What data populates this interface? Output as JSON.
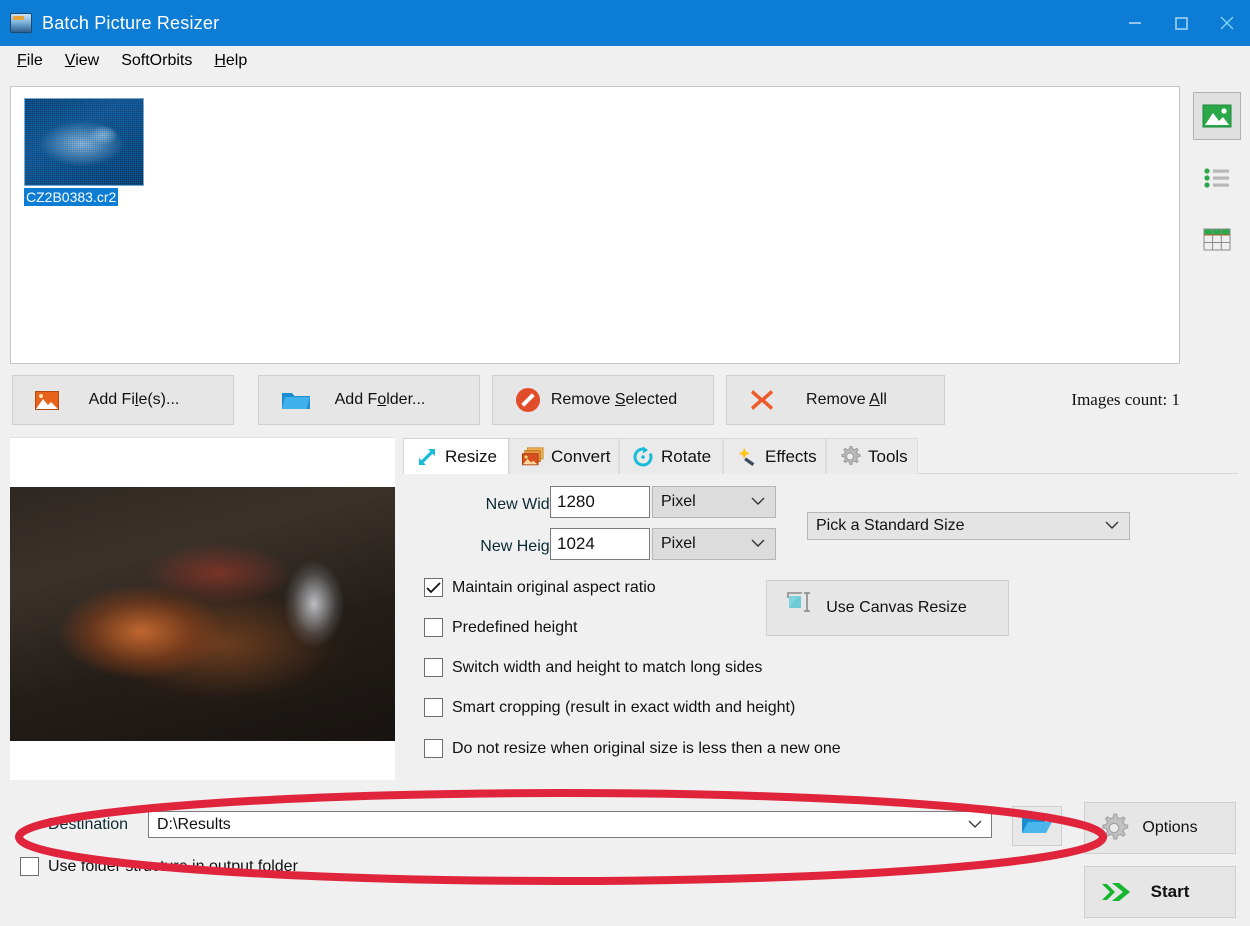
{
  "window": {
    "title": "Batch Picture Resizer",
    "app_icon": "app-picture-icon",
    "controls": {
      "minimize": "minimize-icon",
      "maximize": "maximize-icon",
      "close": "close-icon"
    },
    "titlebar_color": "#0c7cd5"
  },
  "menu": {
    "items": [
      {
        "label": "File",
        "accel": "F"
      },
      {
        "label": "View",
        "accel": "V"
      },
      {
        "label": "SoftOrbits",
        "accel": ""
      },
      {
        "label": "Help",
        "accel": "H"
      }
    ]
  },
  "filelist": {
    "thumbnails": [
      {
        "filename": "CZ2B0383.cr2",
        "selected": true
      }
    ]
  },
  "view_modes": [
    {
      "name": "thumbnail-view",
      "active": true
    },
    {
      "name": "list-view",
      "active": false
    },
    {
      "name": "details-view",
      "active": false
    }
  ],
  "actions": {
    "add_files": {
      "label_pre": "Add Fi",
      "label_accel": "l",
      "label_post": "e(s)...",
      "icon": "image-icon"
    },
    "add_folder": {
      "label_pre": "Add F",
      "label_accel": "o",
      "label_post": "lder...",
      "icon": "folder-icon"
    },
    "remove_selected": {
      "label_pre": "Remove ",
      "label_accel": "S",
      "label_post": "elected",
      "icon": "no-entry-icon"
    },
    "remove_all": {
      "label_pre": "Remove ",
      "label_accel": "A",
      "label_post": "ll",
      "icon": "red-x-icon"
    },
    "images_count": "Images count: 1"
  },
  "tabs": [
    {
      "label": "Resize",
      "icon": "resize-arrows-icon",
      "active": true
    },
    {
      "label": "Convert",
      "icon": "convert-images-icon",
      "active": false
    },
    {
      "label": "Rotate",
      "icon": "rotate-icon",
      "active": false
    },
    {
      "label": "Effects",
      "icon": "magic-wand-icon",
      "active": false
    },
    {
      "label": "Tools",
      "icon": "gear-icon",
      "active": false
    }
  ],
  "resize": {
    "new_width_label": "New Width",
    "new_width_value": "1280",
    "new_width_unit": "Pixel",
    "new_height_label": "New Height",
    "new_height_value": "1024",
    "new_height_unit": "Pixel",
    "standard_size": "Pick a Standard Size",
    "canvas_button": "Use Canvas Resize",
    "checkboxes": [
      {
        "label": "Maintain original aspect ratio",
        "checked": true
      },
      {
        "label": "Predefined height",
        "checked": false
      },
      {
        "label": "Switch width and height to match long sides",
        "checked": false
      },
      {
        "label": "Smart cropping (result in exact width and height)",
        "checked": false
      },
      {
        "label": "Do not resize when original size is less then a new one",
        "checked": false
      }
    ]
  },
  "bottom": {
    "destination_label": "Destination",
    "destination_value": "D:\\Results",
    "browse_icon": "open-folder-icon",
    "use_folder_structure": {
      "label": "Use folder structure in output folder",
      "checked": false
    },
    "options_button": {
      "label": "Options",
      "icon": "gear-icon"
    },
    "start_button": {
      "label": "Start",
      "icon": "green-double-arrow-icon"
    }
  },
  "annotation": {
    "shape": "red-ellipse-highlight",
    "color": "#e0243c"
  }
}
